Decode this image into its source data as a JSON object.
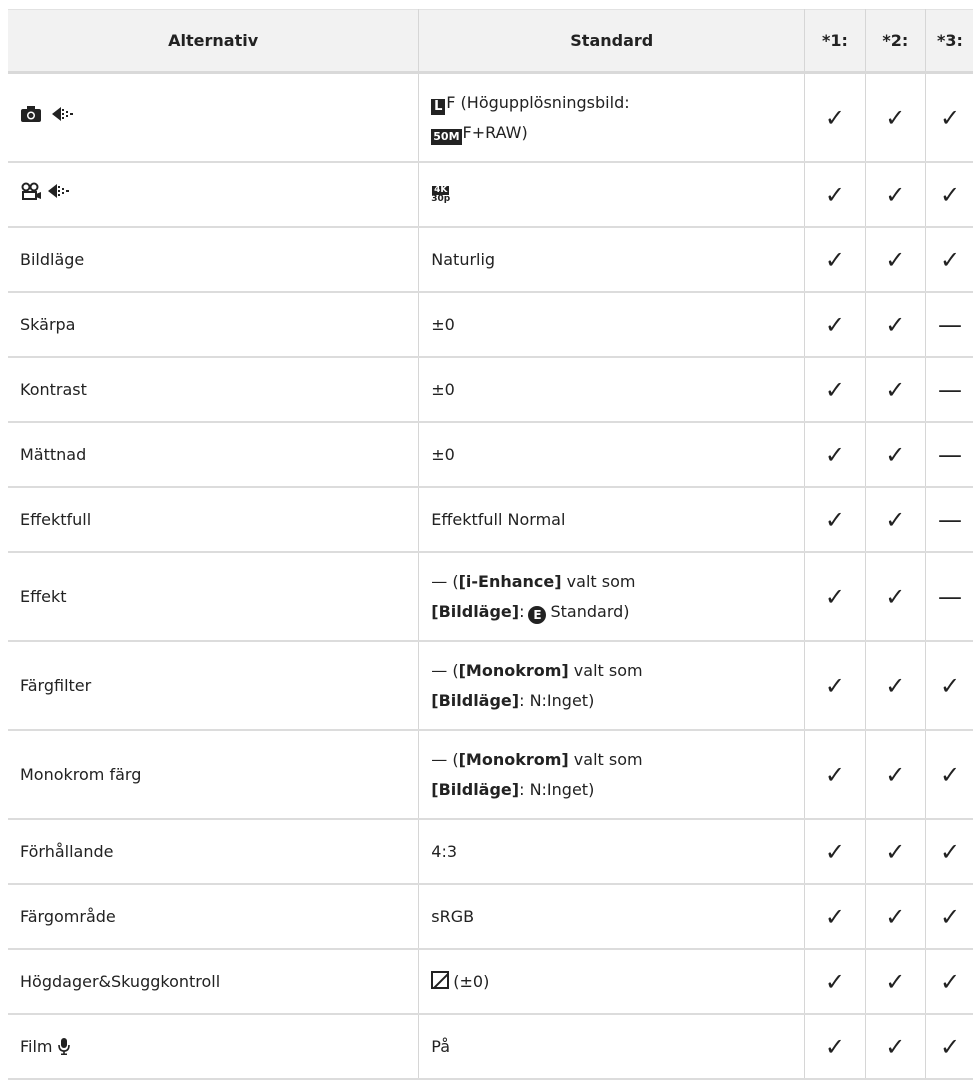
{
  "headers": [
    "Alternativ",
    "Standard",
    "*1:",
    "*2:",
    "*3:"
  ],
  "check_glyph": "✓",
  "dash_glyph": "—",
  "icons": {
    "camera": "camera-icon",
    "movie": "movie-icon",
    "quality": "image-quality-icon",
    "microphone": "microphone-icon"
  },
  "rows": [
    {
      "std_a": "F (Högupplösningsbild:",
      "std_b_prefix": "50M",
      "std_b": "F+RAW)",
      "c1": "✓",
      "c2": "✓",
      "c3": "✓"
    },
    {
      "std_k4": "4K",
      "std_fps": "30p",
      "c1": "✓",
      "c2": "✓",
      "c3": "✓"
    },
    {
      "label": "Bildläge",
      "std": "Naturlig",
      "c1": "✓",
      "c2": "✓",
      "c3": "✓"
    },
    {
      "label": "Skärpa",
      "std": "±0",
      "c1": "✓",
      "c2": "✓",
      "c3": "—"
    },
    {
      "label": "Kontrast",
      "std": "±0",
      "c1": "✓",
      "c2": "✓",
      "c3": "—"
    },
    {
      "label": "Mättnad",
      "std": "±0",
      "c1": "✓",
      "c2": "✓",
      "c3": "—"
    },
    {
      "label": "Effektfull",
      "std": "Effektfull Normal",
      "c1": "✓",
      "c2": "✓",
      "c3": "—"
    },
    {
      "label": "Effekt",
      "std_a1": "— (",
      "std_a2": "[i-Enhance]",
      "std_a3": " valt som",
      "std_b1": "[Bildläge]",
      "std_b2": ":",
      "std_e": "E",
      "std_b3": "Standard)",
      "c1": "✓",
      "c2": "✓",
      "c3": "—"
    },
    {
      "label": "Färgfilter",
      "std_a1": "— (",
      "std_a2": "[Monokrom]",
      "std_a3": " valt som",
      "std_b1": "[Bildläge]",
      "std_b2": ": N:Inget)",
      "c1": "✓",
      "c2": "✓",
      "c3": "✓"
    },
    {
      "label": "Monokrom färg",
      "std_a1": "— (",
      "std_a2": "[Monokrom]",
      "std_a3": " valt som",
      "std_b1": "[Bildläge]",
      "std_b2": ": N:Inget)",
      "c1": "✓",
      "c2": "✓",
      "c3": "✓"
    },
    {
      "label": "Förhållande",
      "std": "4:3",
      "c1": "✓",
      "c2": "✓",
      "c3": "✓"
    },
    {
      "label": "Färgområde",
      "std": "sRGB",
      "c1": "✓",
      "c2": "✓",
      "c3": "✓"
    },
    {
      "label": "Högdager&Skuggkontroll",
      "std": "(±0)",
      "c1": "✓",
      "c2": "✓",
      "c3": "✓"
    },
    {
      "label": "Film",
      "std": "På",
      "c1": "✓",
      "c2": "✓",
      "c3": "✓"
    }
  ]
}
